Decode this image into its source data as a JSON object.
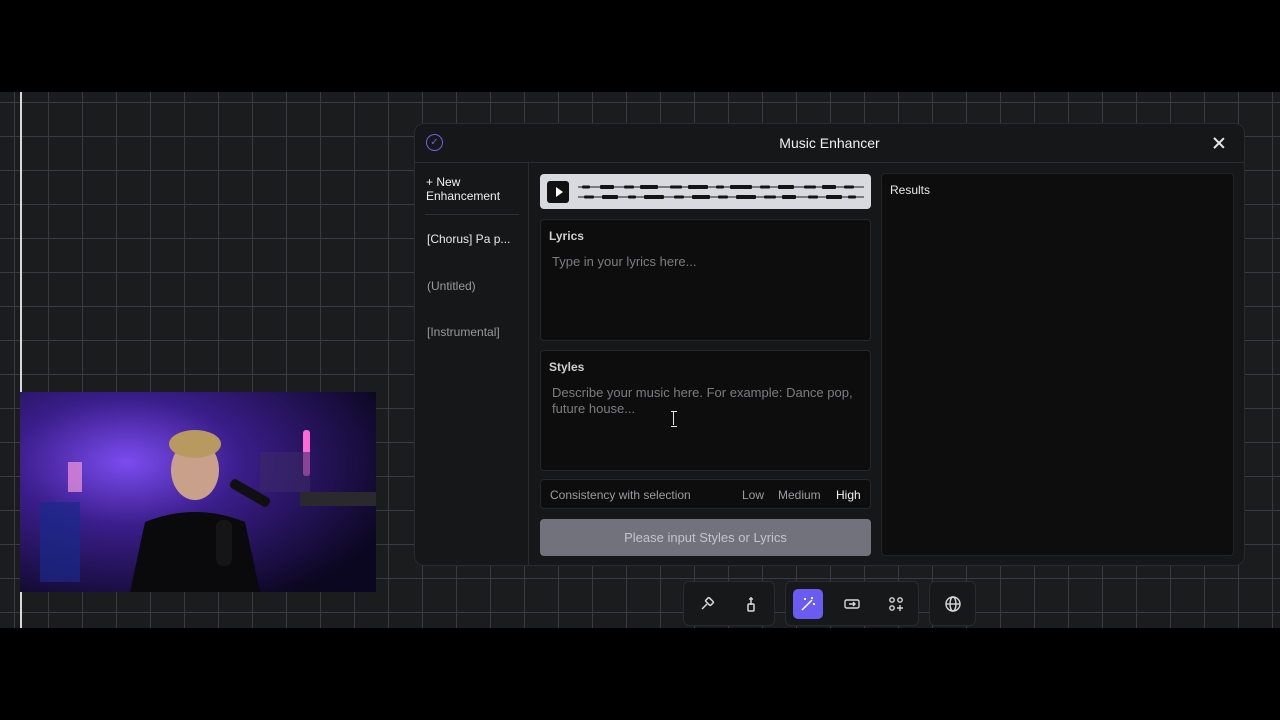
{
  "modal": {
    "title": "Music Enhancer",
    "close_label": "×"
  },
  "sidebar": {
    "new_label": "+ New Enhancement",
    "items": [
      {
        "label": "[Chorus] Pa p...",
        "state": "active"
      },
      {
        "label": "(Untitled)",
        "state": "muted"
      },
      {
        "label": "[Instrumental]",
        "state": "muted"
      }
    ]
  },
  "lyrics": {
    "label": "Lyrics",
    "placeholder": "Type in your lyrics here..."
  },
  "styles": {
    "label": "Styles",
    "placeholder": "Describe your music here. For example: Dance pop, future house..."
  },
  "consistency": {
    "label": "Consistency with selection",
    "options": [
      "Low",
      "Medium",
      "High"
    ],
    "selected": "High"
  },
  "submit": {
    "label": "Please input Styles or Lyrics"
  },
  "results": {
    "label": "Results"
  },
  "toolbar": {
    "tools": [
      "brush-icon",
      "tuning-icon",
      "magic-wand-icon",
      "swap-icon",
      "apps-plus-icon",
      "globe-icon"
    ],
    "active": "magic-wand-icon"
  },
  "colors": {
    "accent": "#6a5cf0",
    "background": "#1b1c1e",
    "panel": "#0d0d0e"
  }
}
